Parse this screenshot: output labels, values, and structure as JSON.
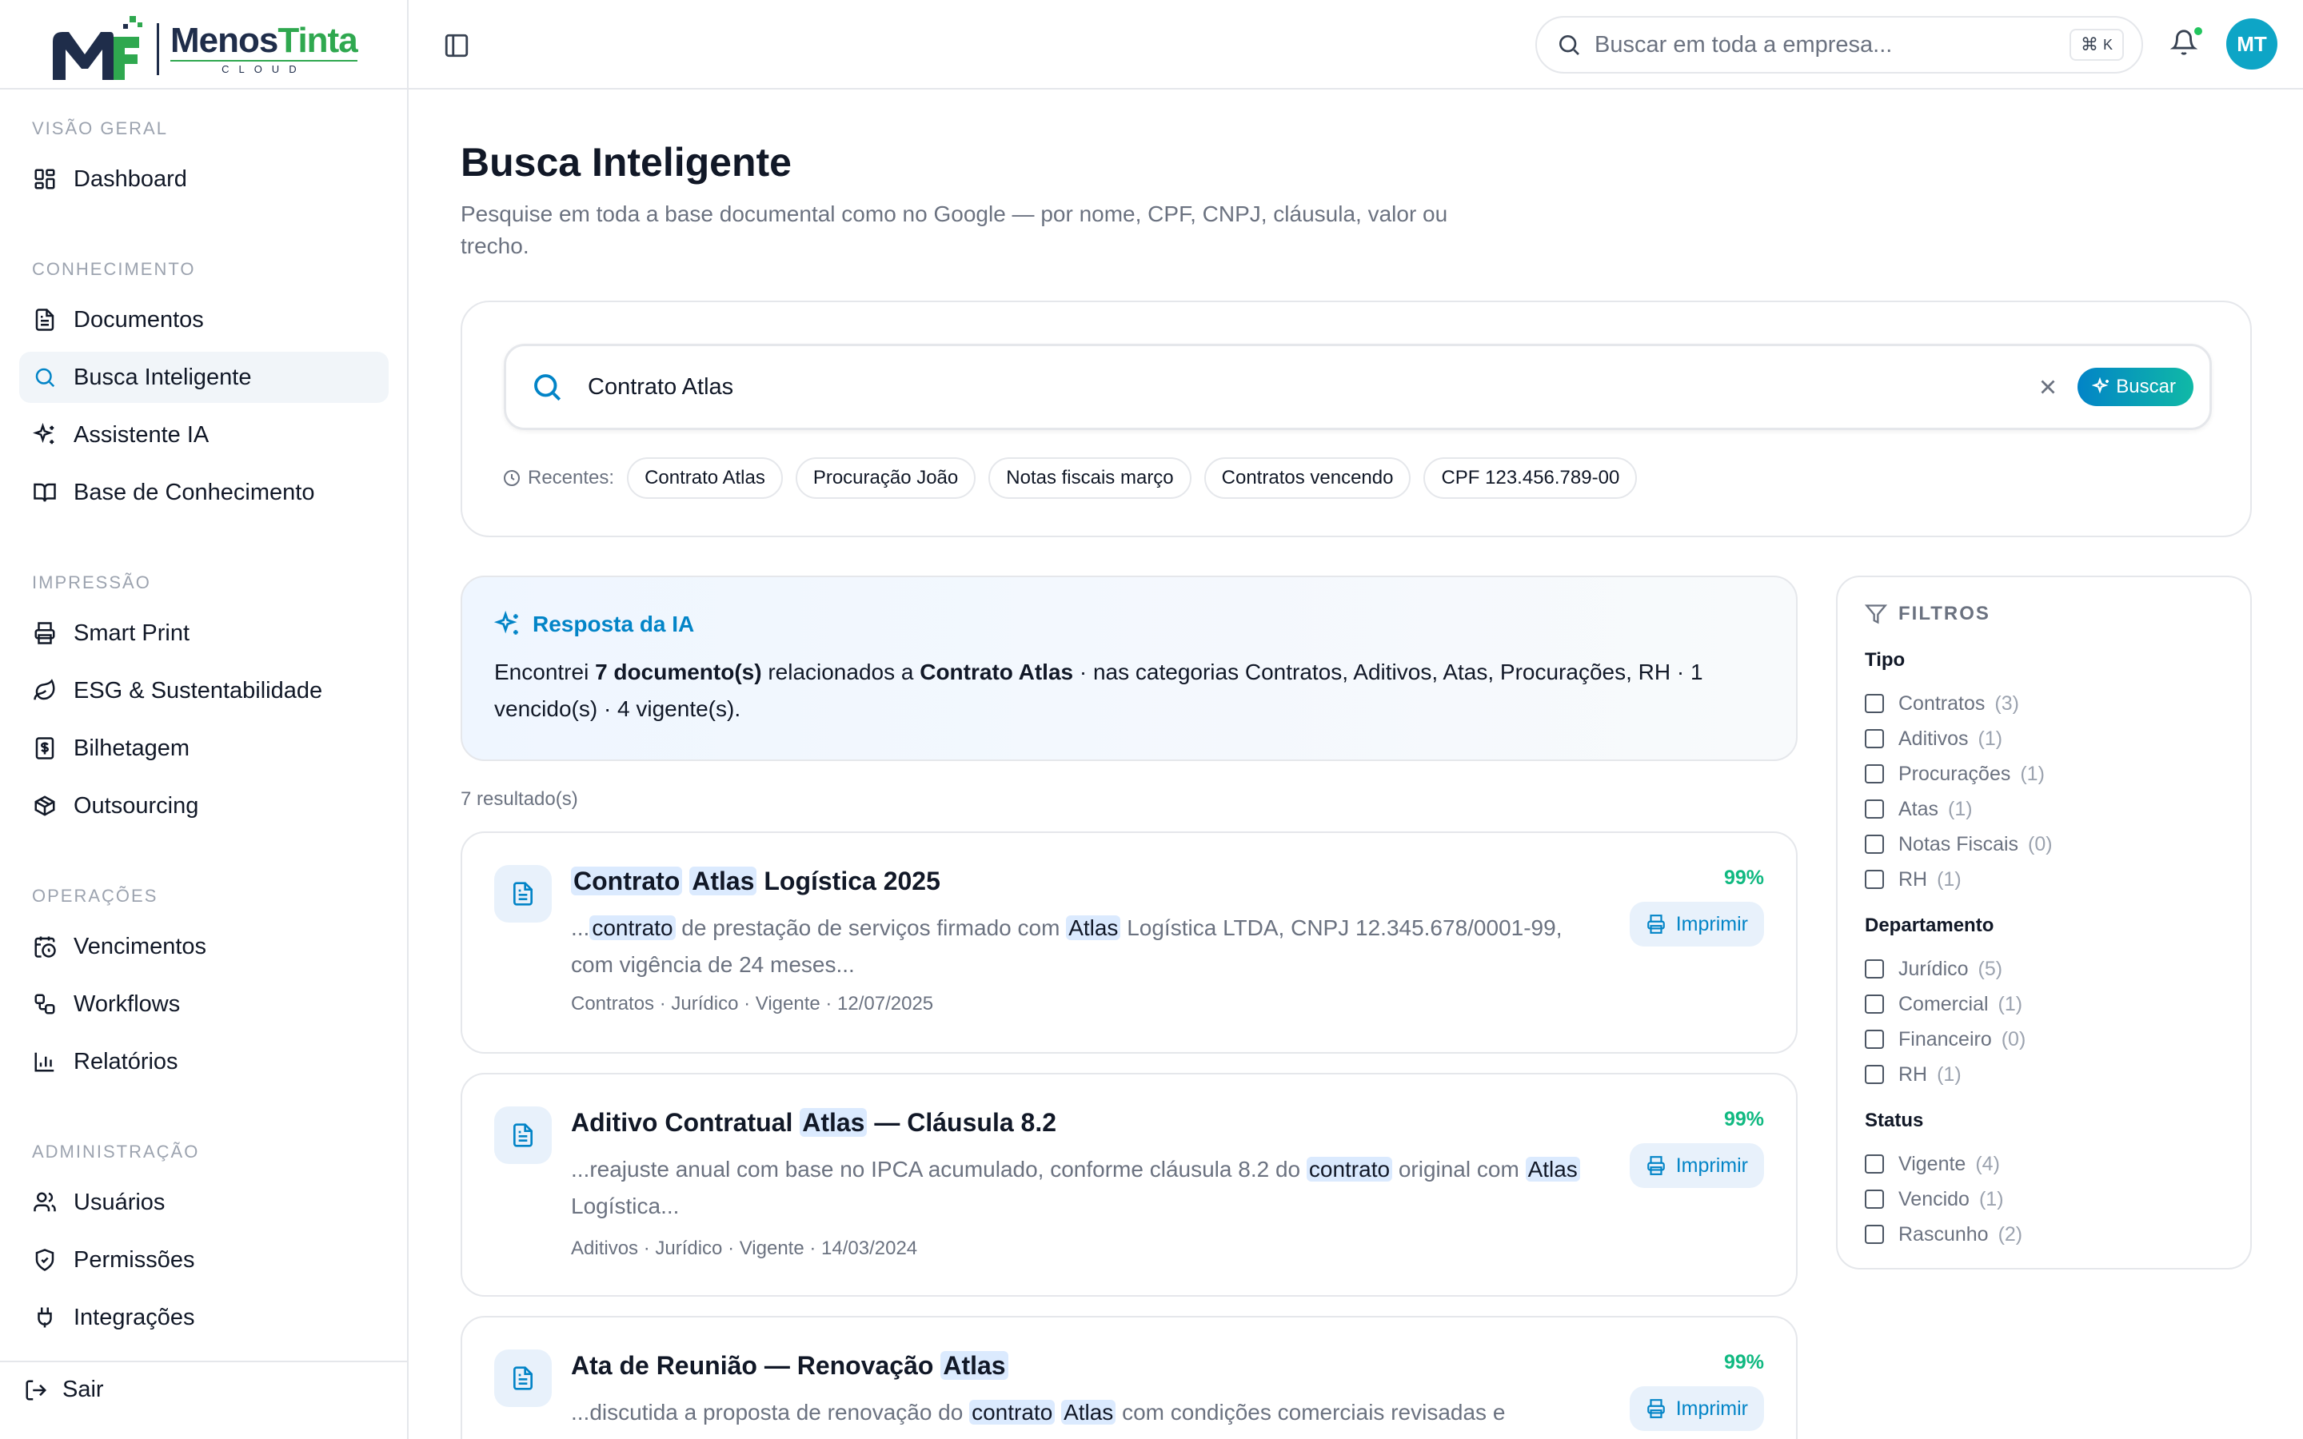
{
  "brand": {
    "name_part1": "Menos",
    "name_part2": "Tinta",
    "sub": "CLOUD"
  },
  "sidebar": {
    "sections": [
      {
        "title": "VISÃO GERAL",
        "items": [
          {
            "label": "Dashboard",
            "icon": "dashboard-icon"
          }
        ]
      },
      {
        "title": "CONHECIMENTO",
        "items": [
          {
            "label": "Documentos",
            "icon": "file-text-icon"
          },
          {
            "label": "Busca Inteligente",
            "icon": "search-icon",
            "active": true
          },
          {
            "label": "Assistente IA",
            "icon": "sparkles-icon"
          },
          {
            "label": "Base de Conhecimento",
            "icon": "book-open-icon"
          }
        ]
      },
      {
        "title": "IMPRESSÃO",
        "items": [
          {
            "label": "Smart Print",
            "icon": "printer-icon"
          },
          {
            "label": "ESG & Sustentabilidade",
            "icon": "leaf-icon"
          },
          {
            "label": "Bilhetagem",
            "icon": "receipt-icon"
          },
          {
            "label": "Outsourcing",
            "icon": "package-icon"
          }
        ]
      },
      {
        "title": "OPERAÇÕES",
        "items": [
          {
            "label": "Vencimentos",
            "icon": "calendar-clock-icon"
          },
          {
            "label": "Workflows",
            "icon": "workflow-icon"
          },
          {
            "label": "Relatórios",
            "icon": "bar-chart-icon"
          }
        ]
      },
      {
        "title": "ADMINISTRAÇÃO",
        "items": [
          {
            "label": "Usuários",
            "icon": "users-icon"
          },
          {
            "label": "Permissões",
            "icon": "shield-check-icon"
          },
          {
            "label": "Integrações",
            "icon": "plug-icon"
          }
        ]
      }
    ],
    "logout": "Sair"
  },
  "topbar": {
    "search_placeholder": "Buscar em toda a empresa...",
    "shortcut_symbol": "⌘",
    "shortcut_key": "K",
    "avatar_initials": "MT"
  },
  "page": {
    "title": "Busca Inteligente",
    "subtitle": "Pesquise em toda a base documental como no Google — por nome, CPF, CNPJ, cláusula, valor ou trecho."
  },
  "search": {
    "value": "Contrato Atlas",
    "button": "Buscar",
    "recents_label": "Recentes:",
    "recents": [
      "Contrato Atlas",
      "Procuração João",
      "Notas fiscais março",
      "Contratos vencendo",
      "CPF 123.456.789-00"
    ]
  },
  "ai_answer": {
    "title": "Resposta da IA",
    "t1": "Encontrei ",
    "count": "7 documento(s)",
    "t2": " relacionados a ",
    "query": "Contrato Atlas",
    "t3": " · nas categorias Contratos, Aditivos, Atas, Procurações, RH · 1 vencido(s) · 4 vigente(s)."
  },
  "results": {
    "count_label": "7 resultado(s)",
    "print_label": "Imprimir",
    "items": [
      {
        "title": [
          {
            "t": "Contrato",
            "h": true
          },
          {
            "t": " "
          },
          {
            "t": "Atlas",
            "h": true
          },
          {
            "t": " Logística 2025"
          }
        ],
        "snippet": [
          {
            "t": "..."
          },
          {
            "t": "contrato",
            "h": true
          },
          {
            "t": " de prestação de serviços firmado com "
          },
          {
            "t": "Atlas",
            "h": true
          },
          {
            "t": " Logística LTDA, CNPJ 12.345.678/0001-99, com vigência de 24 meses..."
          }
        ],
        "meta": "Contratos · Jurídico · Vigente · 12/07/2025",
        "score": "99%"
      },
      {
        "title": [
          {
            "t": "Aditivo Contratual "
          },
          {
            "t": "Atlas",
            "h": true
          },
          {
            "t": " — Cláusula 8.2"
          }
        ],
        "snippet": [
          {
            "t": "...reajuste anual com base no IPCA acumulado, conforme cláusula 8.2 do "
          },
          {
            "t": "contrato",
            "h": true
          },
          {
            "t": " original com "
          },
          {
            "t": "Atlas",
            "h": true
          },
          {
            "t": " Logística..."
          }
        ],
        "meta": "Aditivos · Jurídico · Vigente · 14/03/2024",
        "score": "99%"
      },
      {
        "title": [
          {
            "t": "Ata de Reunião — Renovação "
          },
          {
            "t": "Atlas",
            "h": true
          }
        ],
        "snippet": [
          {
            "t": "...discutida a proposta de renovação do "
          },
          {
            "t": "contrato",
            "h": true
          },
          {
            "t": " "
          },
          {
            "t": "Atlas",
            "h": true
          },
          {
            "t": " com condições comerciais revisadas e"
          }
        ],
        "meta": "",
        "score": "99%"
      }
    ]
  },
  "filters": {
    "title": "FILTROS",
    "groups": [
      {
        "title": "Tipo",
        "options": [
          {
            "label": "Contratos",
            "count": "(3)"
          },
          {
            "label": "Aditivos",
            "count": "(1)"
          },
          {
            "label": "Procurações",
            "count": "(1)"
          },
          {
            "label": "Atas",
            "count": "(1)"
          },
          {
            "label": "Notas Fiscais",
            "count": "(0)"
          },
          {
            "label": "RH",
            "count": "(1)"
          }
        ]
      },
      {
        "title": "Departamento",
        "options": [
          {
            "label": "Jurídico",
            "count": "(5)"
          },
          {
            "label": "Comercial",
            "count": "(1)"
          },
          {
            "label": "Financeiro",
            "count": "(0)"
          },
          {
            "label": "RH",
            "count": "(1)"
          }
        ]
      },
      {
        "title": "Status",
        "options": [
          {
            "label": "Vigente",
            "count": "(4)"
          },
          {
            "label": "Vencido",
            "count": "(1)"
          },
          {
            "label": "Rascunho",
            "count": "(2)"
          }
        ]
      }
    ]
  }
}
